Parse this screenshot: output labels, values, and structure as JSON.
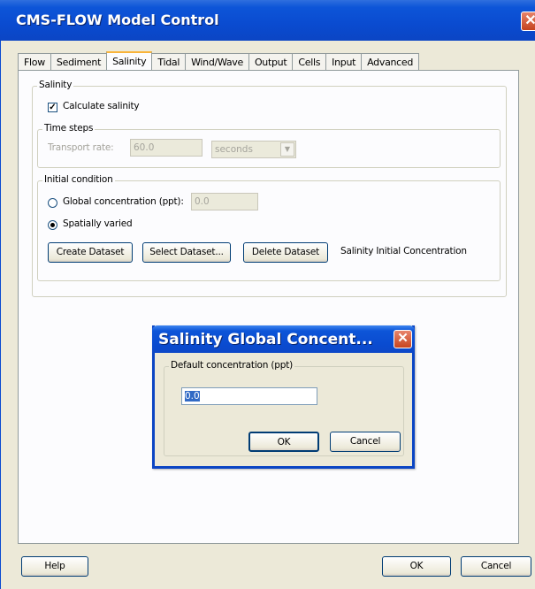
{
  "window": {
    "title": "CMS-FLOW Model Control",
    "close_glyph": "✕"
  },
  "tabs": [
    {
      "label": "Flow"
    },
    {
      "label": "Sediment"
    },
    {
      "label": "Salinity",
      "active": true
    },
    {
      "label": "Tidal"
    },
    {
      "label": "Wind/Wave"
    },
    {
      "label": "Output"
    },
    {
      "label": "Cells"
    },
    {
      "label": "Input"
    },
    {
      "label": "Advanced"
    }
  ],
  "salinity": {
    "group_label": "Salinity",
    "calculate_label": "Calculate salinity",
    "calculate_checked": true,
    "time_steps": {
      "group_label": "Time steps",
      "transport_label": "Transport rate:",
      "transport_value": "60.0",
      "unit_value": "seconds"
    },
    "initial_condition": {
      "group_label": "Initial condition",
      "global_label": "Global concentration (ppt):",
      "global_value": "0.0",
      "spatial_label": "Spatially varied",
      "selected": "spatial",
      "create_button": "Create Dataset",
      "select_button": "Select Dataset...",
      "delete_button": "Delete Dataset",
      "dataset_name": "Salinity Initial Concentration"
    }
  },
  "footer": {
    "help_button": "Help",
    "ok_button": "OK",
    "cancel_button": "Cancel"
  },
  "modal": {
    "title": "Salinity Global Concent...",
    "close_glyph": "✕",
    "group_label": "Default concentration (ppt)",
    "value": "0.0",
    "ok_button": "OK",
    "cancel_button": "Cancel"
  }
}
